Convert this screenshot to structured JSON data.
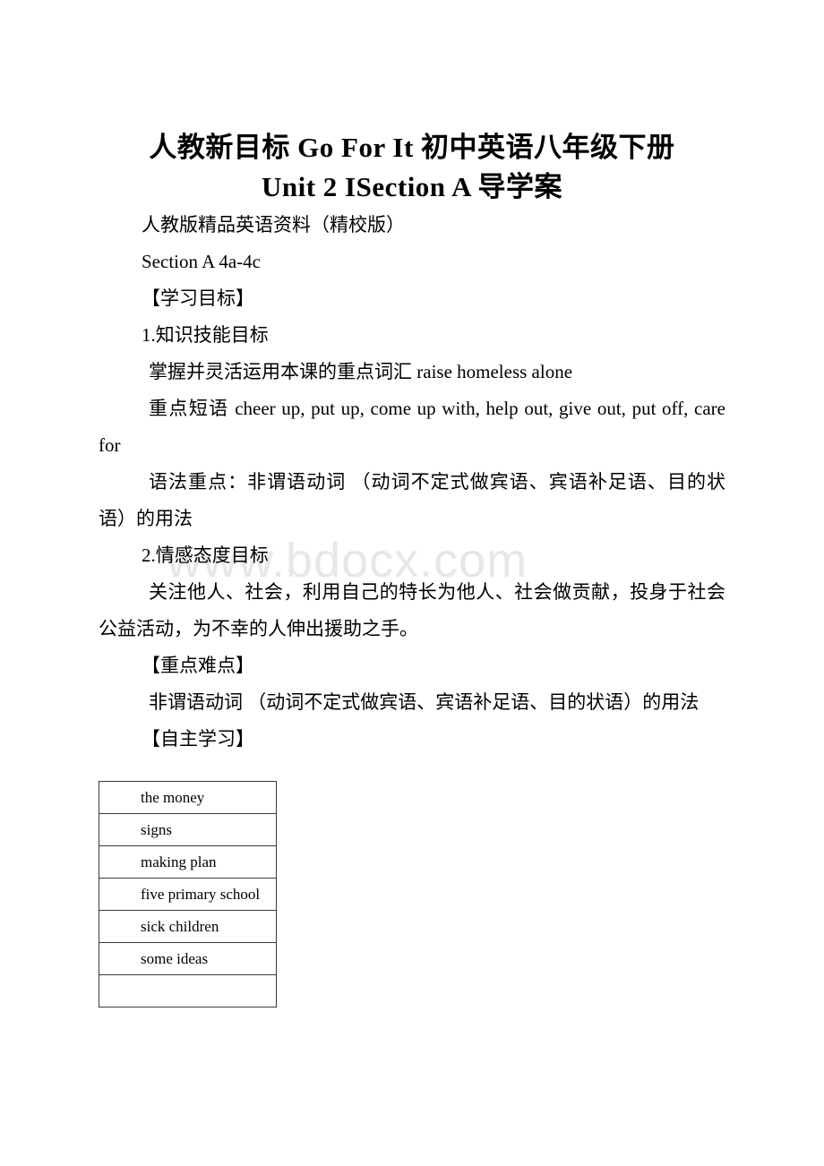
{
  "document": {
    "title_lines": [
      "人教新目标 Go For It 初中英语八年级下册",
      "Unit 2 ISection A 导学案"
    ],
    "watermark": "www.bdocx.com",
    "body": {
      "source_note": "人教版精品英语资料（精校版）",
      "section_label": "Section A 4a-4c",
      "heading_objectives": "【学习目标】",
      "objective_1_title": "1.知识技能目标",
      "objective_1_vocab": "掌握并灵活运用本课的重点词汇 raise homeless alone",
      "objective_1_phrases": "重点短语 cheer up, put up, come up with, help out, give out, put off, care for",
      "objective_1_grammar": "语法重点：非谓语动词 （动词不定式做宾语、宾语补足语、目的状语）的用法",
      "objective_2_title": "2.情感态度目标",
      "objective_2_text": "关注他人、社会，利用自己的特长为他人、社会做贡献，投身于社会公益活动，为不幸的人伸出援助之手。",
      "heading_key_points": "【重点难点】",
      "key_points_text": "非谓语动词 （动词不定式做宾语、宾语补足语、目的状语）的用法",
      "heading_self_study": "【自主学习】"
    },
    "table": {
      "rows": [
        {
          "text": "the money"
        },
        {
          "text": "signs"
        },
        {
          "text": "making plan"
        },
        {
          "text": "five primary school"
        },
        {
          "text": "sick children"
        },
        {
          "text": "some ideas"
        },
        {
          "text": ""
        }
      ]
    }
  }
}
